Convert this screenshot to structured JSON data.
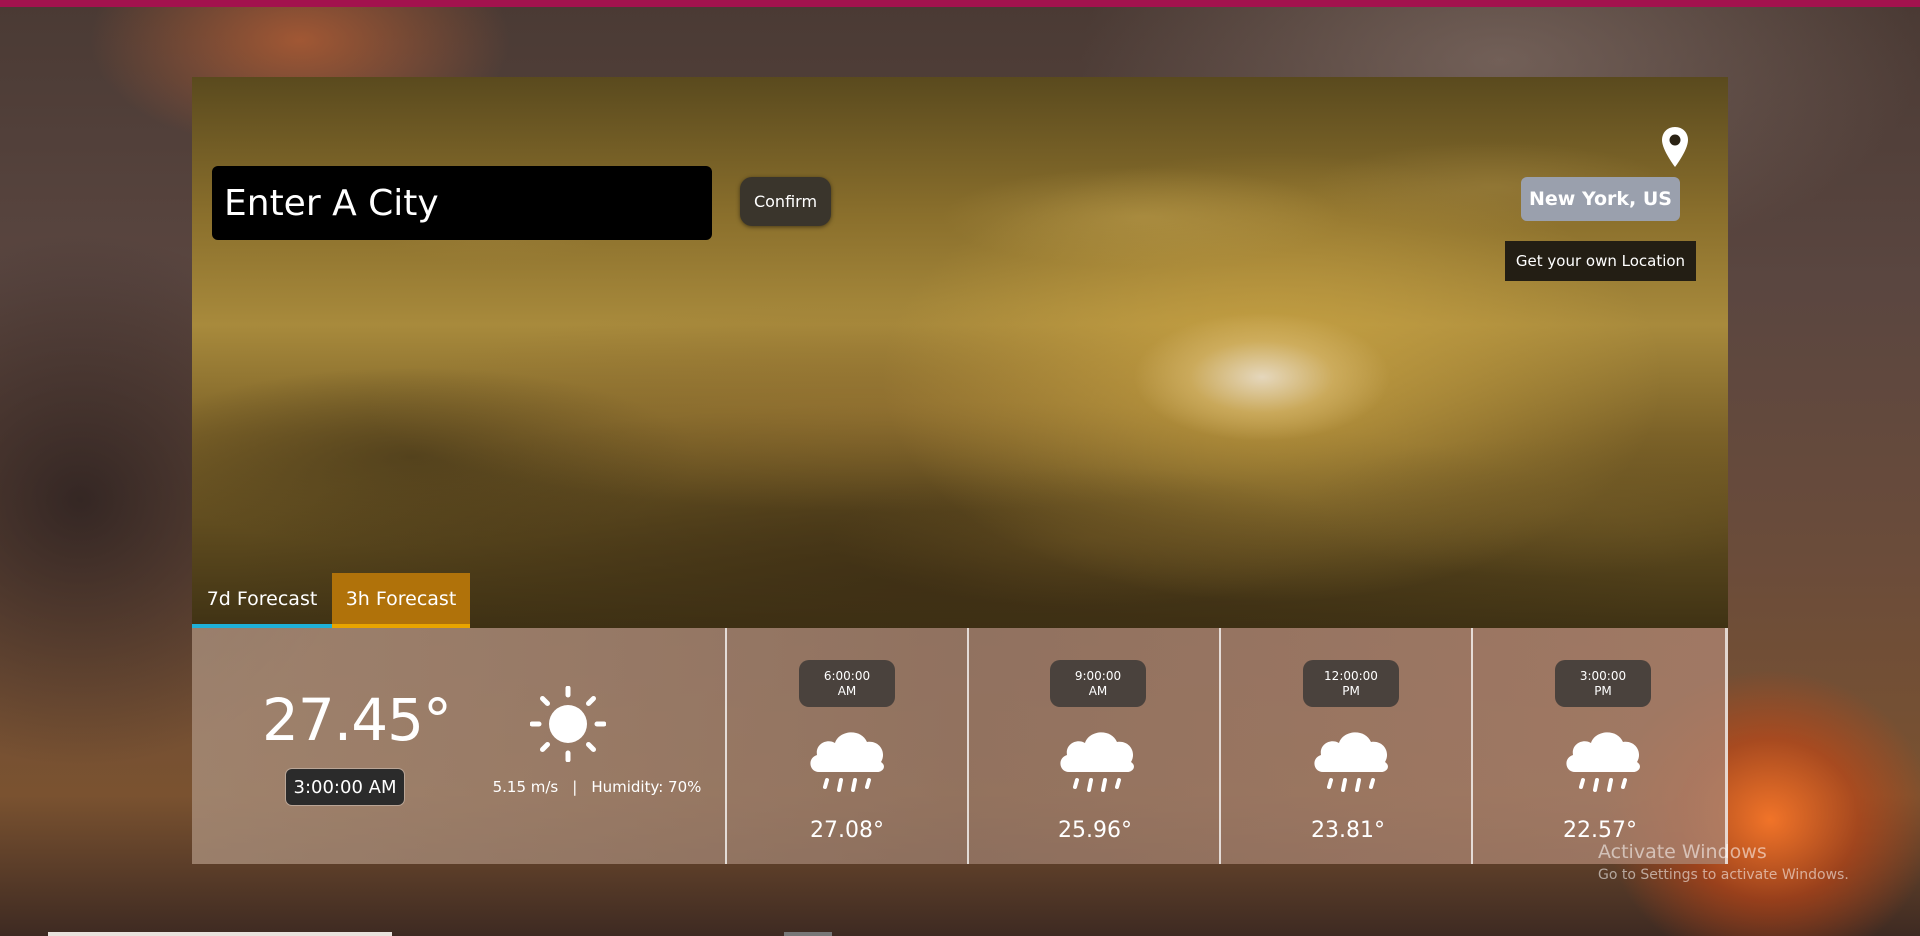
{
  "search": {
    "placeholder": "Enter A City",
    "confirm_label": "Confirm"
  },
  "location": {
    "name": "New York, US",
    "own_location_label": "Get your own Location"
  },
  "tabs": [
    {
      "label": "7d Forecast",
      "active": false
    },
    {
      "label": "3h Forecast",
      "active": true
    }
  ],
  "current": {
    "temperature": "27.45°",
    "time": "3:00:00 AM",
    "wind": "5.15 m/s",
    "separator": "|",
    "humidity": "Humidity: 70%",
    "icon": "sun-icon"
  },
  "forecast": [
    {
      "time": "6:00:00",
      "period": "AM",
      "temperature": "27.08°",
      "icon": "rain-cloud-icon"
    },
    {
      "time": "9:00:00",
      "period": "AM",
      "temperature": "25.96°",
      "icon": "rain-cloud-icon"
    },
    {
      "time": "12:00:00",
      "period": "PM",
      "temperature": "23.81°",
      "icon": "rain-cloud-icon"
    },
    {
      "time": "3:00:00",
      "period": "PM",
      "temperature": "22.57°",
      "icon": "rain-cloud-icon"
    }
  ],
  "watermark": {
    "title": "Activate Windows",
    "subtitle": "Go to Settings to activate Windows."
  },
  "colors": {
    "top_strip": "#a3124e",
    "tab_7d_underline": "#1fb0d8",
    "tab_3h_background": "#b0720a",
    "location_badge": "#9aa0ad"
  }
}
